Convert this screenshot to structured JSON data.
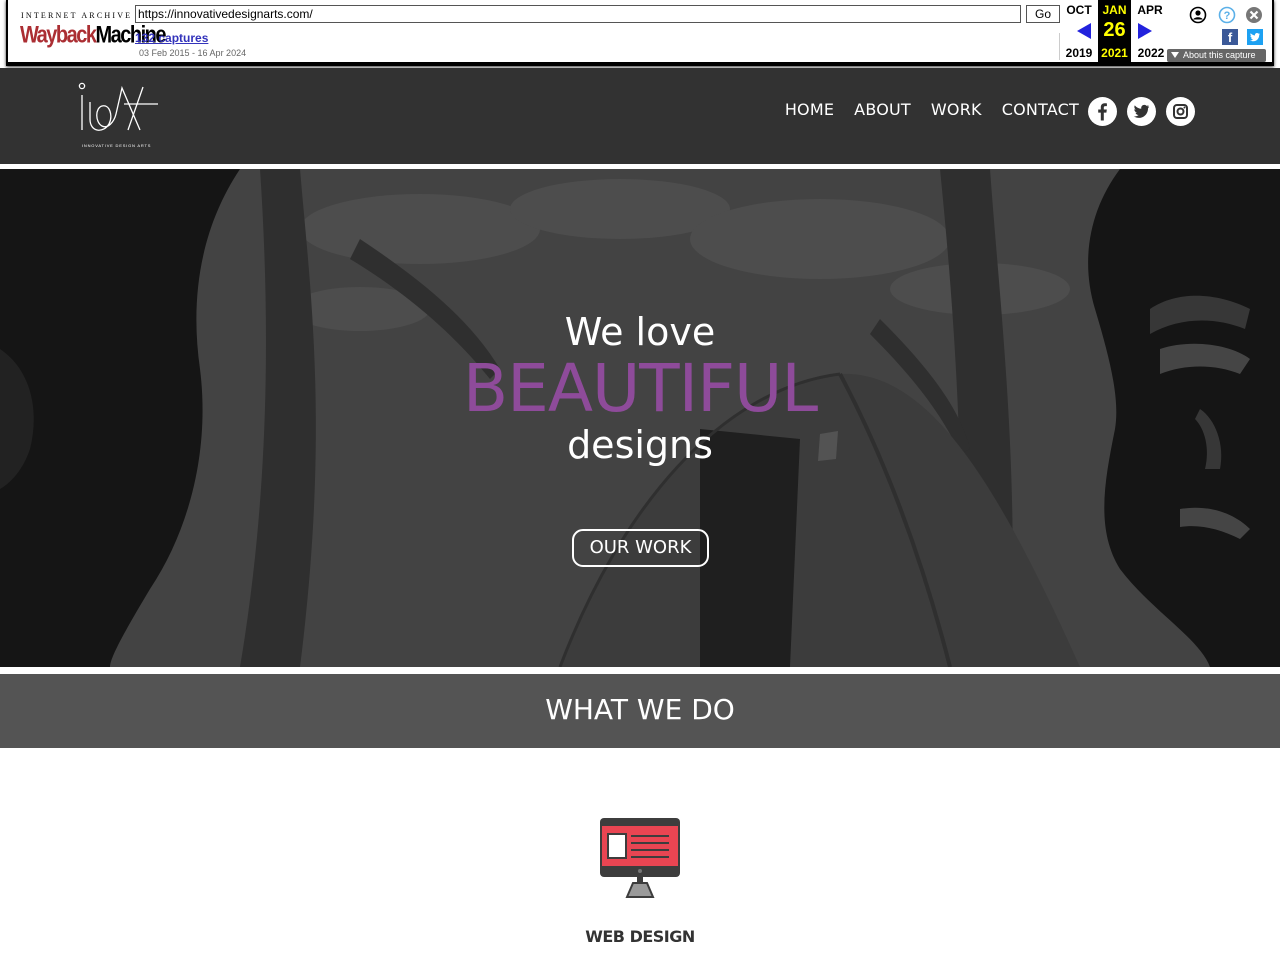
{
  "wayback": {
    "logo_top": "INTERNET ARCHIVE",
    "logo_wayback": "Wayback",
    "logo_machine": "Machine",
    "url": "https://innovativedesignarts.com/",
    "go_label": "Go",
    "captures": "132 captures",
    "range": "03 Feb 2015 - 16 Apr 2024",
    "prev_month": "OCT",
    "prev_year": "2019",
    "cur_month": "JAN",
    "cur_day": "26",
    "cur_year": "2021",
    "next_month": "APR",
    "next_year": "2022",
    "about": "About this capture",
    "fb_glyph": "f"
  },
  "site": {
    "logo_tagline": "INNOVATIVE DESIGN ARTS",
    "nav": [
      "HOME",
      "ABOUT",
      "WORK",
      "CONTACT"
    ],
    "social": [
      "facebook-icon",
      "twitter-icon",
      "instagram-icon"
    ]
  },
  "hero": {
    "line1": "We love",
    "line2": "BEAUTIFUL",
    "line3": "designs",
    "button": "OUR WORK"
  },
  "section": {
    "title": "WHAT WE DO",
    "service_label": "WEB DESIGN"
  },
  "colors": {
    "header_bg": "#323232",
    "accent": "#8e4b9a",
    "section_bg": "#545454",
    "icon_red": "#e94552"
  }
}
